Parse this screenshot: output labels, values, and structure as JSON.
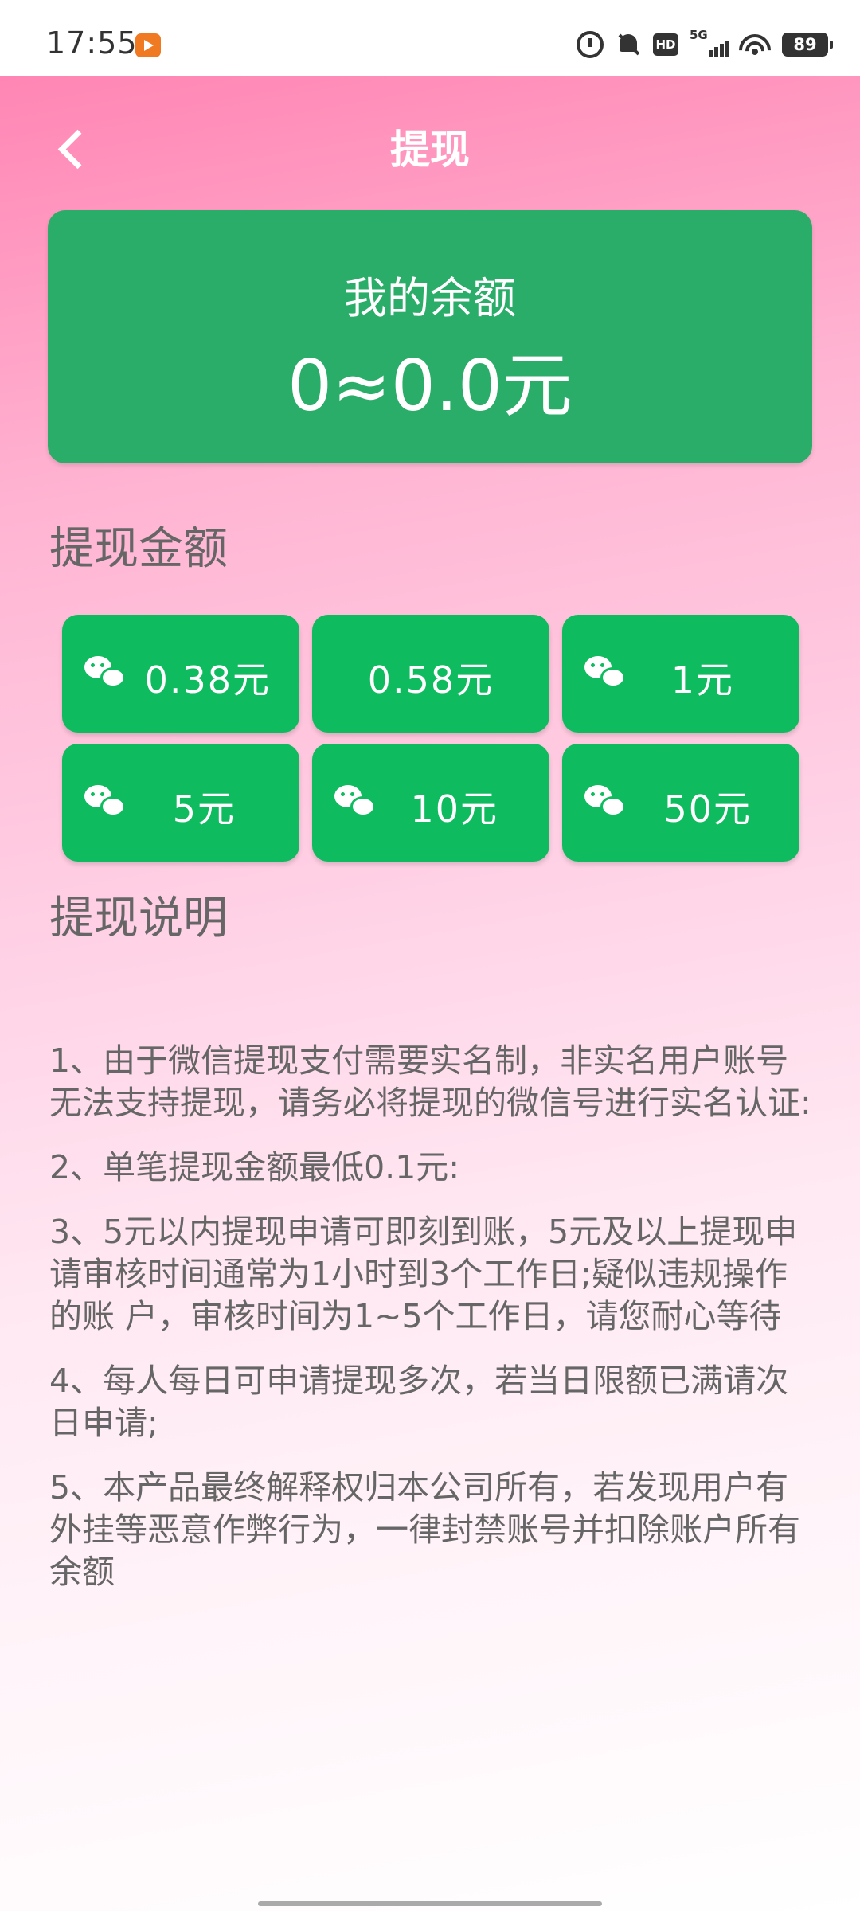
{
  "status_bar": {
    "time": "17:55",
    "hd_label": "HD",
    "network_label": "5G",
    "battery_level": "89"
  },
  "header": {
    "title": "提现"
  },
  "balance": {
    "label": "我的余额",
    "value": "0≈0.0元"
  },
  "withdraw_amount": {
    "title": "提现金额",
    "options": [
      {
        "label": "0.38元",
        "icon": "wechat-icon"
      },
      {
        "label": "0.58元",
        "icon": ""
      },
      {
        "label": "1元",
        "icon": "wechat-icon"
      },
      {
        "label": "5元",
        "icon": "wechat-icon"
      },
      {
        "label": "10元",
        "icon": "wechat-icon"
      },
      {
        "label": "50元",
        "icon": "wechat-icon"
      }
    ]
  },
  "instructions": {
    "title": "提现说明",
    "items": [
      "1、由于微信提现支付需要实名制，非实名用户账号无法支持提现，请务必将提现的微信号进行实名认证:",
      "2、单笔提现金额最低0.1元:",
      "3、5元以内提现申请可即刻到账，5元及以上提现申请审核时间通常为1小时到3个工作日;疑似违规操作的账 户，审核时间为1~5个工作日，请您耐心等待",
      "4、每人每日可申请提现多次，若当日限额已满请次日申请;",
      "5、本产品最终解释权归本公司所有，若发现用户有外挂等恶意作弊行为，一律封禁账号并扣除账户所有余额"
    ]
  },
  "colors": {
    "card_green": "#2bad6a",
    "button_green": "#0fbb5f",
    "gradient_top": "#ff86b4",
    "text_gray": "#666666"
  }
}
